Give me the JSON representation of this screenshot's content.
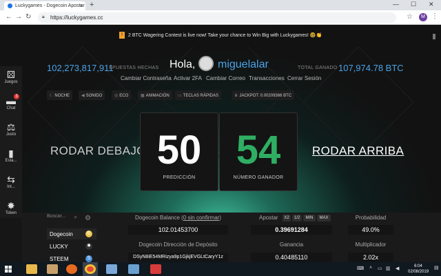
{
  "browser": {
    "tab_title": "Luckygames - Dogecoin Apostar",
    "tab_close": "×",
    "new_tab": "+",
    "minimize": "—",
    "maximize": "☐",
    "close": "✕",
    "url": "https://luckygames.cc",
    "nav_back": "←",
    "nav_forward": "→",
    "nav_reload": "↻",
    "star": "☆",
    "profile_initial": "M",
    "menu": "⋮"
  },
  "announcement": {
    "badge": "!",
    "text": "2 BTC Wagering Contest is live now! Take your chance to Win Big with Luckygames! 🤓👏"
  },
  "sidebar": {
    "items": [
      {
        "label": "Juegos",
        "icon": "dice-icon",
        "glyph": "⚄"
      },
      {
        "label": "Chat",
        "icon": "chat-icon",
        "glyph": "▬",
        "badge": "3"
      },
      {
        "label": "Justo",
        "icon": "scale-icon",
        "glyph": "⚖"
      },
      {
        "label": "Esta...",
        "icon": "bar-chart-icon",
        "glyph": "▮"
      },
      {
        "label": "Int...",
        "icon": "swap-icon",
        "glyph": "⇆"
      },
      {
        "label": "Token",
        "icon": "token-icon",
        "glyph": "✸"
      }
    ]
  },
  "stats": {
    "bets_value": "102,273,817,911",
    "bets_label": "APUESTAS HECHAS",
    "won_label": "TOTAL GANADO",
    "won_value": "107,974.78 BTC"
  },
  "user": {
    "greeting": "Hola,",
    "name": "miguelalar",
    "links": [
      "Cambiar Contraseña",
      "Activar 2FA",
      "Cambiar Correo",
      "Transacciones",
      "Cerrar Sesión"
    ]
  },
  "options": [
    {
      "label": "NOCHE",
      "icon": "moon-icon",
      "glyph": "☾"
    },
    {
      "label": "SONIDO",
      "icon": "speaker-icon",
      "glyph": "◀"
    },
    {
      "label": "ECO",
      "icon": "eco-icon",
      "glyph": "◎"
    },
    {
      "label": "ANIMACIÓN",
      "icon": "animation-icon",
      "glyph": "▦"
    },
    {
      "label": "TECLAS RÁPIDAS",
      "icon": "keyboard-icon",
      "glyph": "▭"
    },
    {
      "label": "JACKPOT: 0.00209366 BTC",
      "icon": "jackpot-icon",
      "glyph": "♛"
    }
  ],
  "game": {
    "roll_under": "RODAR DEBAJO",
    "roll_over": "RODAR ARRIBA",
    "prediction_value": "50",
    "prediction_label": "PREDICCIÓN",
    "winning_value": "54",
    "winning_label": "NÚMERO GANADOR",
    "prediction_color": "#ffffff",
    "winning_color": "#2fae63"
  },
  "wallet": {
    "search_placeholder": "Buscar...",
    "coins": [
      {
        "name": "Dogecoin",
        "icon": "dogecoin-icon",
        "glyph": "Ð",
        "color": "#e8c44a"
      },
      {
        "name": "LUCKY",
        "icon": "lucky-icon",
        "glyph": "✸",
        "color": "#333"
      },
      {
        "name": "STEEM",
        "icon": "steem-icon",
        "glyph": "S",
        "color": "#4a90d9"
      }
    ],
    "balance_label_prefix": "Dogecoin Balance (",
    "balance_label_link": "0 sin confirmar",
    "balance_label_suffix": ")",
    "balance_value": "102.01453700",
    "deposit_label": "Dogecoin Dirección de Depósito",
    "deposit_value": "DSyN8iE54MRizya9p1GjkjEVGLtCaryY1z"
  },
  "bet": {
    "bet_label": "Apostar",
    "buttons": [
      "X2",
      "1/2",
      "MIN",
      "MAX"
    ],
    "bet_value": "0.39691284",
    "profit_label": "Ganancia",
    "profit_value": "0.40485110",
    "prob_label": "Probabilidad",
    "prob_value": "49.0%",
    "mult_label": "Multiplicador",
    "mult_value": "2.02x"
  },
  "taskbar": {
    "time": "6:04",
    "date": "02/08/2019"
  }
}
